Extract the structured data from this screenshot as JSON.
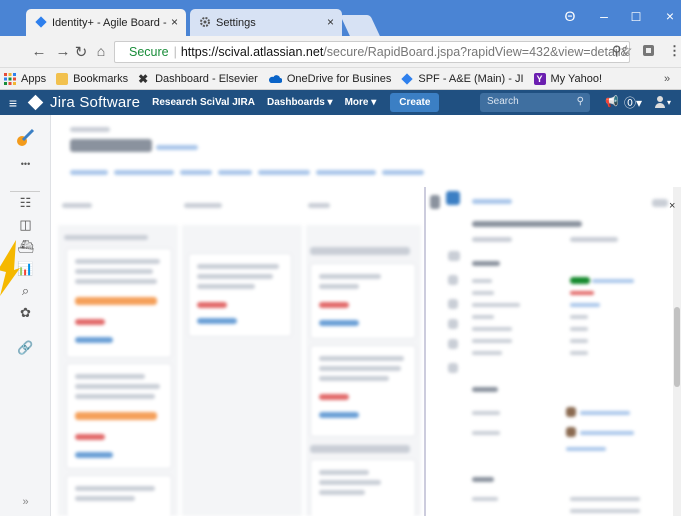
{
  "tabs": [
    {
      "label": "Identity+ - Agile Board -",
      "close": "×"
    },
    {
      "label": "Settings",
      "close": "×"
    }
  ],
  "window": {
    "minimize": "–",
    "maximize": "☐",
    "close": "×",
    "profile": "Θ"
  },
  "address": {
    "secure": "Secure",
    "separator": "|",
    "host": "https://scival.atlassian.net",
    "path": "/secure/RapidBoard.jspa?rapidView=432&view=detail&s..."
  },
  "bookmarks": [
    {
      "label": "Apps",
      "color": "#e44c3a"
    },
    {
      "label": "Bookmarks",
      "color": "#f2b632"
    },
    {
      "label": "Dashboard - Elsevier",
      "color": "#333333"
    },
    {
      "label": "OneDrive for Busines",
      "color": "#0a64c8"
    },
    {
      "label": "SPF - A&E (Main) - JI",
      "color": "#2f80ed"
    },
    {
      "label": "My Yahoo!",
      "color": "#6b1fb0"
    }
  ],
  "bookmarks_more": "»",
  "jira": {
    "logo": "Jira Software",
    "project": "Research SciVal JIRA",
    "dashboards": "Dashboards ▾",
    "more": "More ▾",
    "create": "Create",
    "search_placeholder": "Search"
  },
  "sidebar": {
    "more_dots": "•••",
    "expand": "»"
  },
  "icons": {
    "brand_blue": "#205081",
    "create_blue": "#3b7fc4"
  }
}
